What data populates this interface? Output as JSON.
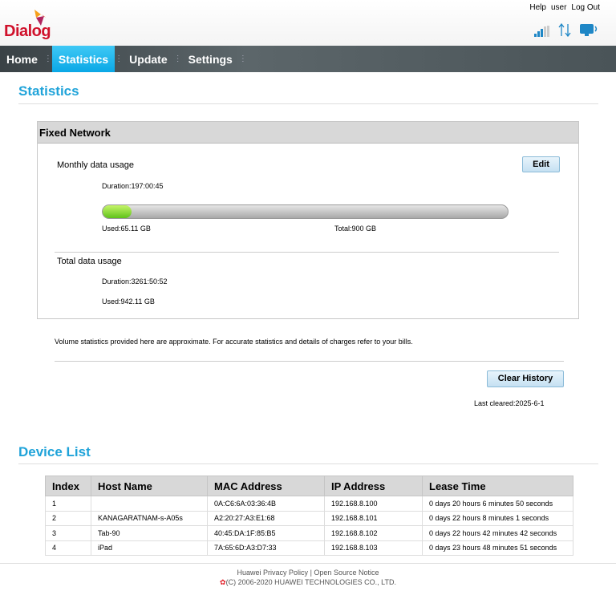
{
  "header": {
    "logo_text": "Dialog",
    "links": {
      "help": "Help",
      "user": "user",
      "logout": "Log Out"
    }
  },
  "nav": [
    {
      "label": "Home"
    },
    {
      "label": "Statistics"
    },
    {
      "label": "Update"
    },
    {
      "label": "Settings"
    }
  ],
  "statistics": {
    "title": "Statistics",
    "panel_title": "Fixed Network",
    "monthly_label": "Monthly data usage",
    "edit_label": "Edit",
    "monthly_duration": "Duration:197:00:45",
    "monthly_used": "Used:65.11 GB",
    "monthly_total": "Total:900 GB",
    "usage_fraction": 0.072,
    "total_label": "Total data usage",
    "total_duration": "Duration:3261:50:52",
    "total_used": "Used:942.11 GB",
    "notice": "Volume statistics provided here are approximate. For accurate statistics and details of charges refer to your bills.",
    "clear_label": "Clear History",
    "last_cleared": "Last cleared:2025-6-1"
  },
  "device_list": {
    "title": "Device List",
    "headers": [
      "Index",
      "Host Name",
      "MAC Address",
      "IP Address",
      "Lease Time"
    ],
    "rows": [
      [
        "1",
        "",
        "0A:C6:6A:03:36:4B",
        "192.168.8.100",
        "0 days 20 hours 6 minutes 50 seconds"
      ],
      [
        "2",
        "KANAGARATNAM-s-A05s",
        "A2:20:27:A3:E1:68",
        "192.168.8.101",
        "0 days 22 hours 8 minutes 1 seconds"
      ],
      [
        "3",
        "Tab-90",
        "40:45:DA:1F:85:B5",
        "192.168.8.102",
        "0 days 22 hours 42 minutes 42 seconds"
      ],
      [
        "4",
        "iPad",
        "7A:65:6D:A3:D7:33",
        "192.168.8.103",
        "0 days 23 hours 48 minutes 51 seconds"
      ]
    ]
  },
  "footer": {
    "privacy": "Huawei Privacy Policy",
    "sep": "|",
    "opensource": "Open Source Notice",
    "copyright": "(C) 2006-2020 HUAWEI TECHNOLOGIES CO., LTD."
  }
}
